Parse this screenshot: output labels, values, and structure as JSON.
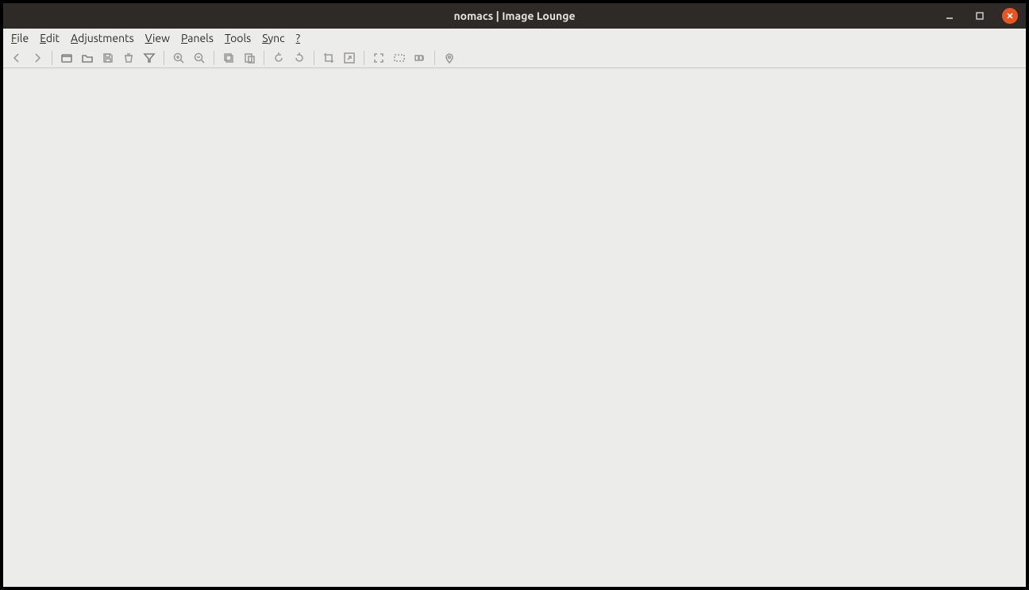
{
  "window": {
    "title": "nomacs | Image Lounge"
  },
  "menu": {
    "file": {
      "label": "File",
      "accel_index": 0
    },
    "edit": {
      "label": "Edit",
      "accel_index": 0
    },
    "adjustments": {
      "label": "Adjustments",
      "accel_index": 0
    },
    "view": {
      "label": "View",
      "accel_index": 0
    },
    "panels": {
      "label": "Panels",
      "accel_index": 0
    },
    "tools": {
      "label": "Tools",
      "accel_index": 0
    },
    "sync": {
      "label": "Sync",
      "accel_index": 0
    },
    "help": {
      "label": "?",
      "accel_index": 0
    }
  },
  "toolbar": {
    "previous": "Previous",
    "next": "Next",
    "open_file": "Open file",
    "open_folder": "Open folder",
    "save": "Save",
    "delete": "Delete",
    "filter": "Filter",
    "zoom_in": "Zoom in",
    "zoom_out": "Zoom out",
    "copy": "Copy",
    "paste": "Paste",
    "rotate_ccw": "Rotate counter-clockwise",
    "rotate_cw": "Rotate clockwise",
    "crop": "Crop",
    "resize": "Resize",
    "fullscreen": "Toggle fullscreen",
    "fit_window": "Fit window",
    "thumbnails": "Thumbnail preview",
    "gps": "GPS location"
  }
}
